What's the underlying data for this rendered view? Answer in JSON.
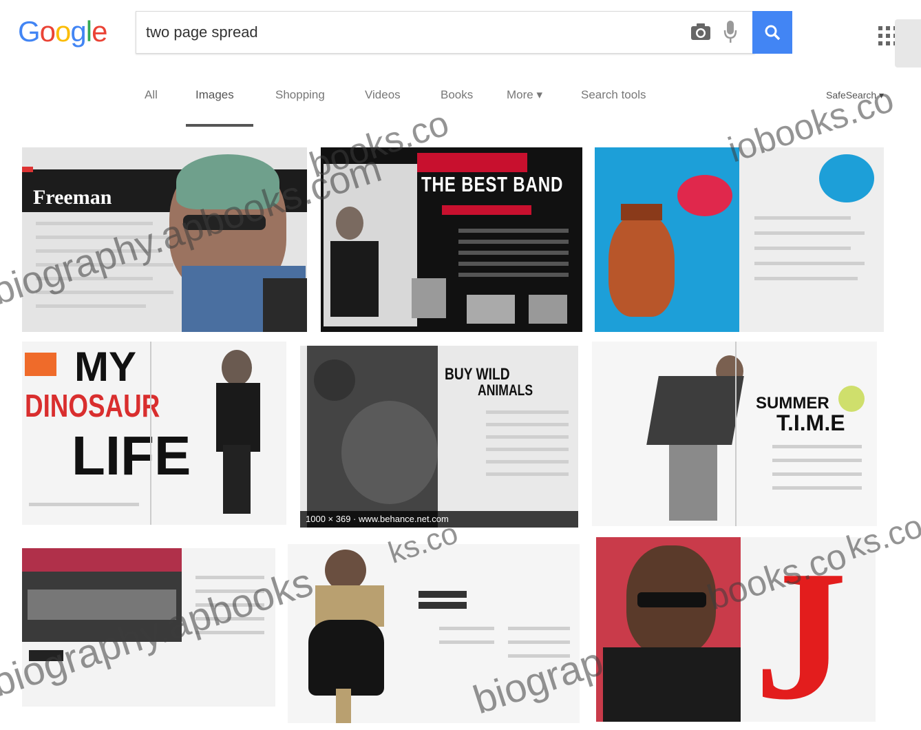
{
  "header": {
    "logo_letters": [
      "G",
      "o",
      "o",
      "g",
      "l",
      "e"
    ],
    "search_value": "two page spread",
    "colors": {
      "blue": "#4285f4",
      "red": "#ea4335",
      "yellow": "#fbbc05",
      "green": "#34a853"
    }
  },
  "tabs": [
    {
      "label": "All",
      "active": false
    },
    {
      "label": "Images",
      "active": true
    },
    {
      "label": "Shopping",
      "active": false
    },
    {
      "label": "Videos",
      "active": false
    },
    {
      "label": "Books",
      "active": false
    },
    {
      "label": "More ▾",
      "active": false
    },
    {
      "label": "Search tools",
      "active": false
    }
  ],
  "safesearch_label": "SafeSearch ▾",
  "results": {
    "freeman": {
      "title": "Freeman"
    },
    "band": {
      "title": "THE BEST BAND"
    },
    "dinosaur": {
      "line1": "MY",
      "line2": "DINOSAUR",
      "line3": "LIFE"
    },
    "animals": {
      "line1": "BUY WILD",
      "line2": "ANIMALS",
      "caption": "1000 × 369 · www.behance.net.com"
    },
    "summer": {
      "line1": "SUMMER",
      "line2": "T.I.M.E"
    },
    "j": {
      "letter": "J"
    }
  },
  "watermarks": [
    "biography.apbooks.com",
    "books.co",
    "iobooks.co",
    "ks.co",
    "biography.apbooks",
    "books.co",
    "biograp",
    "ks.co"
  ]
}
